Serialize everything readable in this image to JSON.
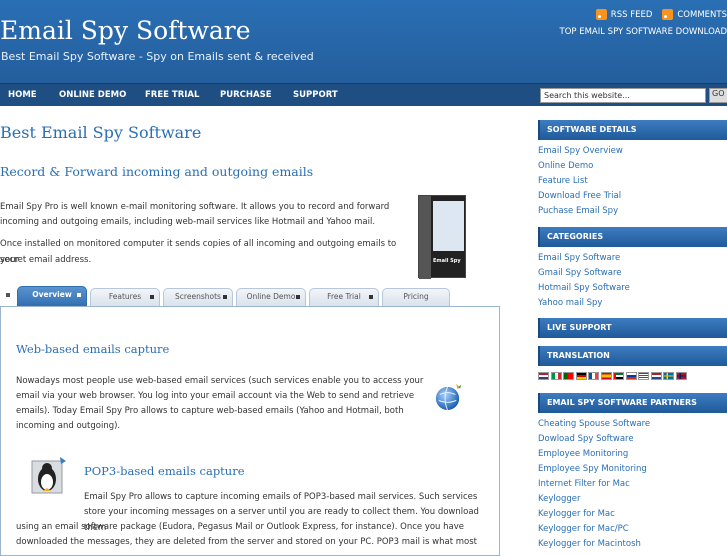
{
  "header": {
    "title": "Email Spy Software",
    "tagline": "Best Email Spy Software - Spy on Emails sent & received",
    "rss_feed": "RSS FEED",
    "comments": "COMMENTS",
    "top_download": "TOP EMAIL SPY SOFTWARE DOWNLOAD"
  },
  "nav": {
    "items": [
      "HOME",
      "ONLINE DEMO",
      "FREE TRIAL",
      "PURCHASE",
      "SUPPORT"
    ],
    "search_placeholder": "Search this website...",
    "go": "GO"
  },
  "main": {
    "title": "Best Email Spy Software",
    "subtitle": "Record & Forward incoming and outgoing emails",
    "intro1_line1": "Email Spy Pro is well known e-mail monitoring software. It allows you to record and forward",
    "intro1_line2": "incoming and outgoing emails, including web-mail services like Hotmail and Yahoo mail.",
    "intro2_line1": "Once installed on monitored computer it sends copies of all incoming and outgoing emails to your",
    "intro2_line2": "secret email address.",
    "product_label": "Email Spy",
    "tabs": [
      "Overview",
      "Features",
      "Screenshots",
      "Online Demo",
      "Free Trial",
      "Pricing"
    ]
  },
  "panel": {
    "h1": "Web-based emails capture",
    "p1": [
      "Nowadays most people use web-based email services (such services enable you to access your",
      "email via your web browser. You log into your email account via the Web to send and retrieve",
      "emails). Today Email Spy Pro allows to capture web-based emails (Yahoo and Hotmail, both",
      "incoming and outgoing)."
    ],
    "h2": "POP3-based emails capture",
    "p2": [
      "Email Spy Pro allows to capture incoming emails of POP3-based mail services. Such services",
      "store your incoming messages on a server until you are ready to collect them. You download them",
      "using an email software package (Eudora, Pegasus Mail or Outlook Express, for instance). Once you have",
      "downloaded the messages, they are deleted from the server and stored on your PC. POP3 mail is what most"
    ]
  },
  "sidebar": {
    "software_details": "SOFTWARE DETAILS",
    "details_links": [
      "Email Spy Overview",
      "Online Demo",
      "Feature List",
      "Download Free Trial",
      "Puchase Email Spy"
    ],
    "categories": "CATEGORIES",
    "category_links": [
      "Email Spy Software",
      "Gmail Spy Software",
      "Hotmail Spy Software",
      "Yahoo mail Spy"
    ],
    "live_support": "LIVE SUPPORT",
    "translation": "TRANSLATION",
    "partners": "EMAIL SPY SOFTWARE PARTNERS",
    "partner_links": [
      "Cheating Spouse Software",
      "Dowload Spy Software",
      "Employee Monitoring",
      "Employee Spy Monitoring",
      "Internet Filter for Mac",
      "Keylogger",
      "Keylogger for Mac",
      "Keylogger for Mac/PC",
      "Keylogger for Macintosh"
    ]
  },
  "colors": {
    "brand_blue": "#2a6fb4",
    "nav_blue": "#1f4f82",
    "rss_orange": "#f7931e"
  },
  "icons": [
    "rss-icon",
    "globe-icon",
    "tux-penguin-icon"
  ]
}
